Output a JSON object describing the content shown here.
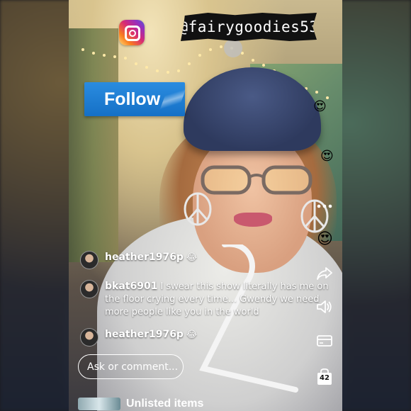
{
  "overlay": {
    "platform_icon": "instagram-icon",
    "handle": "@fairygoodies53",
    "follow_label": "Follow"
  },
  "floating_reactions": [
    "😍",
    "😍",
    "😍"
  ],
  "side_actions": [
    {
      "icon": "more-options-icon"
    },
    {
      "icon": "share-icon"
    },
    {
      "icon": "volume-icon"
    },
    {
      "icon": "card-icon"
    },
    {
      "icon": "bag-icon",
      "count": "42"
    }
  ],
  "comments": [
    {
      "user": "heather1976p",
      "text": "😂"
    },
    {
      "user": "bkat6901",
      "text": "I swear this show literally has me on the floor crying every time... Gwendy we need more people like you in the world"
    },
    {
      "user": "heather1976p",
      "text": "😂"
    }
  ],
  "comment_input": {
    "placeholder": "Ask or comment..."
  },
  "footer": {
    "label": "Unlisted items"
  },
  "colors": {
    "follow_bg": "#1a7fd6",
    "background": "#1b1b1f"
  }
}
